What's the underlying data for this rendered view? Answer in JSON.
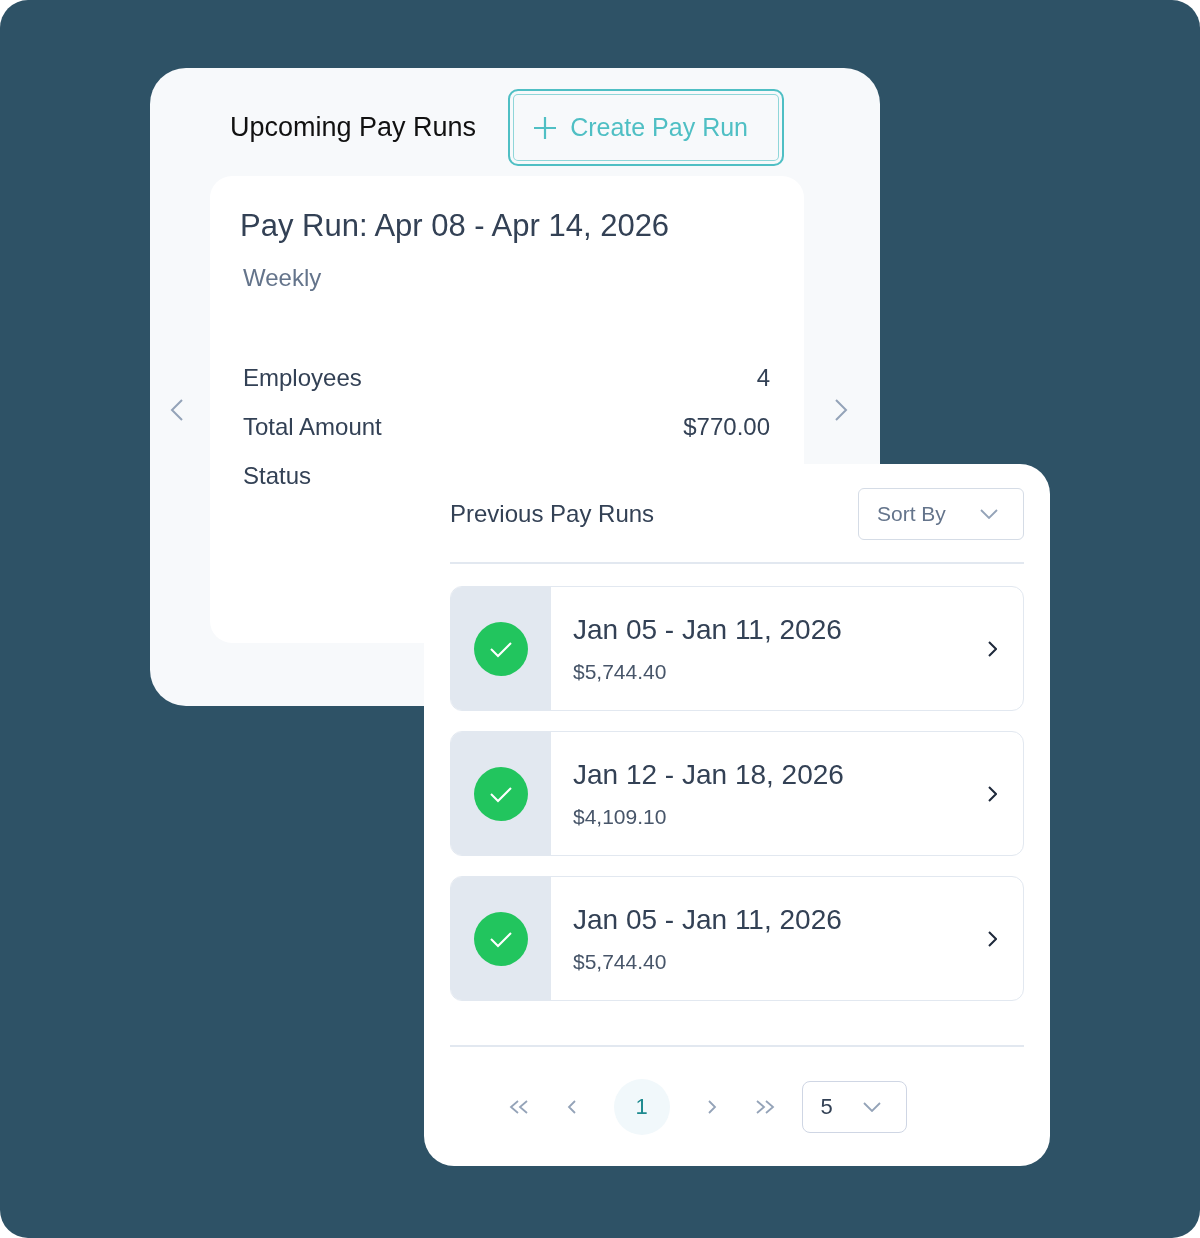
{
  "upcoming": {
    "title": "Upcoming Pay Runs",
    "create_button": "Create Pay Run",
    "pay_run": {
      "title": "Pay Run: Apr 08 -  Apr 14, 2026",
      "frequency": "Weekly",
      "details": [
        {
          "label": "Employees",
          "value": "4"
        },
        {
          "label": "Total Amount",
          "value": "$770.00"
        },
        {
          "label": "Status"
        }
      ]
    }
  },
  "previous": {
    "title": "Previous Pay Runs",
    "sort_placeholder": "Sort By",
    "runs": [
      {
        "period": "Jan 05 - Jan 11, 2026",
        "amount": "$5,744.40"
      },
      {
        "period": "Jan 12 - Jan 18, 2026",
        "amount": "$4,109.10"
      },
      {
        "period": "Jan 05 - Jan 11, 2026",
        "amount": "$5,744.40"
      }
    ],
    "pagination": {
      "pages": [
        {
          "label": "1",
          "selected": true
        }
      ],
      "page_size": "5"
    }
  }
}
